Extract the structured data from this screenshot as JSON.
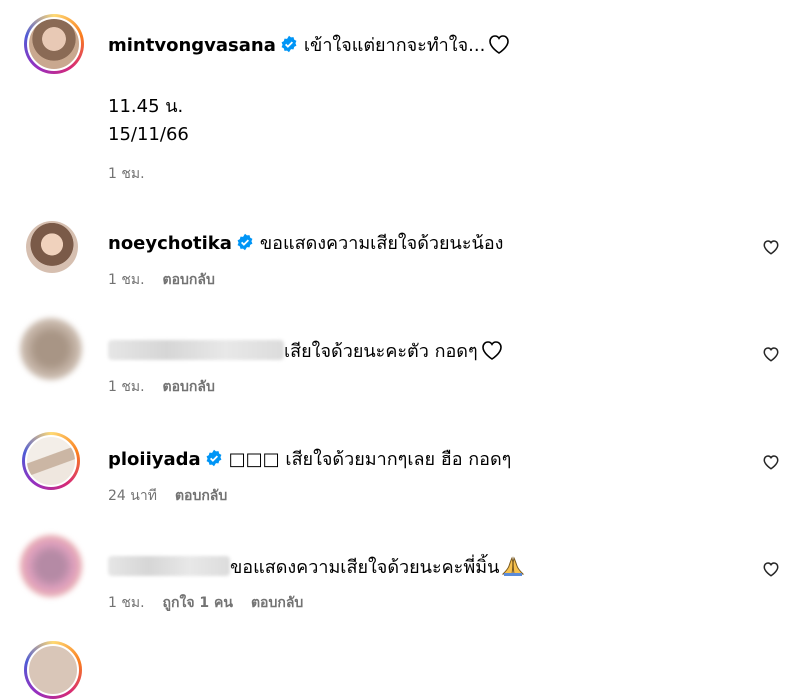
{
  "caption": {
    "username": "mintvongvasana",
    "text": "เข้าใจแต่ยากจะทำใจ...",
    "body_line1": "11.45 น.",
    "body_line2": "15/11/66",
    "time": "1 ชม."
  },
  "comments": [
    {
      "username": "noeychotika",
      "verified": true,
      "text": "ขอแสดงความเสียใจด้วยนะน้อง",
      "time": "1 ชม.",
      "likes": "",
      "reply": "ตอบกลับ"
    },
    {
      "username": "",
      "verified": false,
      "text": "เสียใจด้วยนะคะตัว กอดๆ",
      "time": "1 ชม.",
      "likes": "",
      "reply": "ตอบกลับ"
    },
    {
      "username": "ploiiyada",
      "verified": true,
      "text": "□□□ เสียใจด้วยมากๆเลย ฮือ กอดๆ",
      "time": "24 นาที",
      "likes": "",
      "reply": "ตอบกลับ"
    },
    {
      "username": "",
      "verified": false,
      "text": "ขอแสดงความเสียใจด้วยนะคะพี่มิ้น",
      "time": "1 ชม.",
      "likes": "ถูกใจ 1 คน",
      "reply": "ตอบกลับ"
    }
  ],
  "icons": {
    "verified": "verified-badge-icon",
    "heart": "heart-outline-icon",
    "pray": "folded-hands-emoji"
  },
  "colors": {
    "verified": "#0095f6",
    "meta": "#737373"
  }
}
